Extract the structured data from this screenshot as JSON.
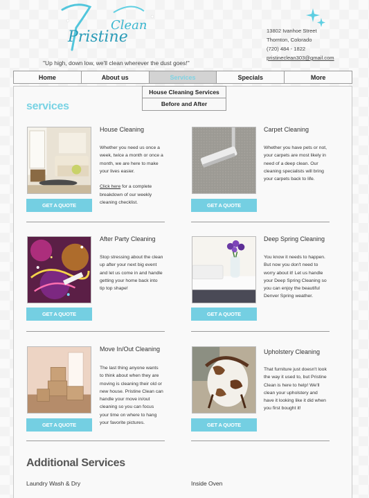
{
  "header": {
    "logo_text_main": "Pristine",
    "logo_text_accent": "Clean",
    "tagline": "\"Up high, down low, we'll clean wherever the dust goes!\"",
    "address_line1": "13802 Ivanhoe Street",
    "address_line2": "Thornton, Colorado",
    "phone": "(720) 484 - 1822",
    "email": "pristineclean303@gmail.com"
  },
  "nav": {
    "items": [
      {
        "label": "Home"
      },
      {
        "label": "About us"
      },
      {
        "label": "Services"
      },
      {
        "label": "Specials"
      },
      {
        "label": "More"
      }
    ],
    "active_index": 2
  },
  "dropdown": {
    "items": [
      {
        "label": "House Cleaning Services"
      },
      {
        "label": "Before and After"
      }
    ]
  },
  "main": {
    "section_title": "services",
    "quote_label": "GET A QUOTE",
    "cards": [
      {
        "title": "House Cleaning",
        "desc": "Whether you need us once a week, twice a month or once a month, we are here to make your lives easier.",
        "link_text": "Click here",
        "link_rest": " for a complete breakdown of our weekly cleaning checklist.",
        "icon": "living-room-photo"
      },
      {
        "title": "Carpet Cleaning",
        "desc": "Whether you have pets or not, your carpets are most likely in need of a deep clean. Our cleaning specialists will bring your carpets back to life.",
        "icon": "vacuum-carpet-photo"
      },
      {
        "title": "After Party Cleaning",
        "desc": "Stop stressing about the clean up after your next big event and let us come in and handle getting your home back into tip top shape!",
        "icon": "party-confetti-photo"
      },
      {
        "title": "Deep Spring Cleaning",
        "desc": "You know it needs to happen. But now you don't need to worry about it! Let us handle your Deep Spring Cleaning so you can enjoy the beautiful Denver Spring weather.",
        "icon": "flowers-bed-photo"
      },
      {
        "title": "Move In/Out Cleaning",
        "desc": "The last thing anyone wants to think about when they are moving is cleaning their old or new house. Pristine Clean can handle your move in/out cleaning so you can focus your time on where to hang your favorite pictures.",
        "icon": "moving-boxes-photo"
      },
      {
        "title": "Upholstery Cleaning",
        "desc": "That furniture just doesn't look the way it used to, but Pristine Clean is here to help! We'll clean your upholstery and have it looking like it did when you first bought it!",
        "icon": "cowhide-chair-photo"
      }
    ]
  },
  "additional": {
    "title": "Additional Services",
    "items": [
      {
        "label": "Laundry Wash & Dry"
      },
      {
        "label": "Inside Oven"
      }
    ]
  },
  "colors": {
    "accent": "#74cfe2",
    "background": "#f3f3f3",
    "nav_active": "#d3d3d3"
  }
}
